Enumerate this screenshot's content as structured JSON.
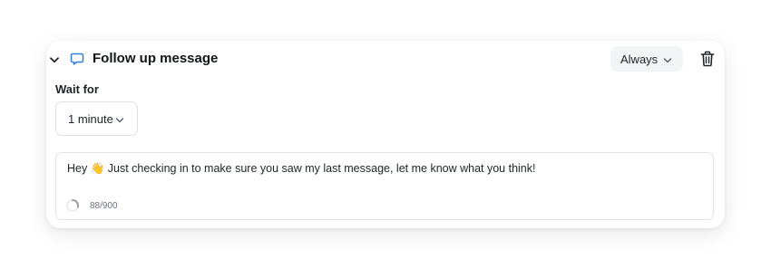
{
  "card": {
    "title": "Follow up message",
    "icons": {
      "collapse": "chevron-down-icon",
      "message": "speech-bubble-icon",
      "delete": "trash-icon"
    },
    "frequency": {
      "selected": "Always"
    }
  },
  "wait": {
    "label": "Wait for",
    "selected": "1 minute"
  },
  "message": {
    "text": "Hey 👋 Just checking in to make sure you saw my last message, let me know what you think!",
    "char_count": "88/900",
    "char_progress": 0.098
  },
  "colors": {
    "accent": "#2f7fd9",
    "spinner": "#9aa0a6"
  }
}
